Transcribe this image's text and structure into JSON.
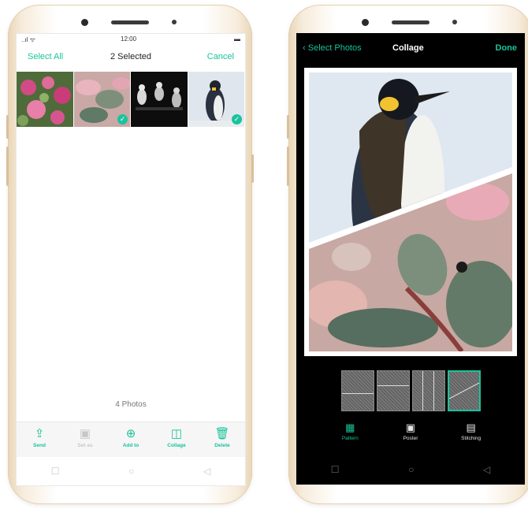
{
  "left_phone": {
    "status": {
      "signal": "..ıl ᯤ",
      "time": "12:00",
      "battery": "▬"
    },
    "header": {
      "select_all": "Select All",
      "title": "2 Selected",
      "cancel": "Cancel"
    },
    "thumbnails": [
      {
        "name": "pink-flowers",
        "selected": false
      },
      {
        "name": "pink-leaves",
        "selected": true
      },
      {
        "name": "dark-figures",
        "selected": false
      },
      {
        "name": "penguin",
        "selected": true
      }
    ],
    "photos_count": "4 Photos",
    "toolbar": [
      {
        "label": "Send",
        "icon": "share-icon",
        "glyph": "⇪",
        "enabled": true
      },
      {
        "label": "Set as",
        "icon": "set-as-icon",
        "glyph": "▣",
        "enabled": false
      },
      {
        "label": "Add to",
        "icon": "add-icon",
        "glyph": "⊕",
        "enabled": true
      },
      {
        "label": "Collage",
        "icon": "collage-icon",
        "glyph": "◫",
        "enabled": true
      },
      {
        "label": "Delete",
        "icon": "trash-icon",
        "glyph": "🗑",
        "enabled": true
      }
    ],
    "nav": {
      "recent": "☐",
      "home": "○",
      "back": "◁"
    }
  },
  "right_phone": {
    "header": {
      "back": "Select Photos",
      "title": "Collage",
      "done": "Done"
    },
    "tabs": [
      {
        "label": "Pattern",
        "icon": "pattern-icon",
        "glyph": "▦",
        "active": true
      },
      {
        "label": "Poster",
        "icon": "poster-icon",
        "glyph": "▣",
        "active": false
      },
      {
        "label": "Stitching",
        "icon": "stitching-icon",
        "glyph": "▤",
        "active": false
      }
    ],
    "nav": {
      "recent": "☐",
      "home": "○",
      "back": "◁"
    }
  },
  "colors": {
    "accent": "#19c39b",
    "shell": "#f7ecdc"
  }
}
